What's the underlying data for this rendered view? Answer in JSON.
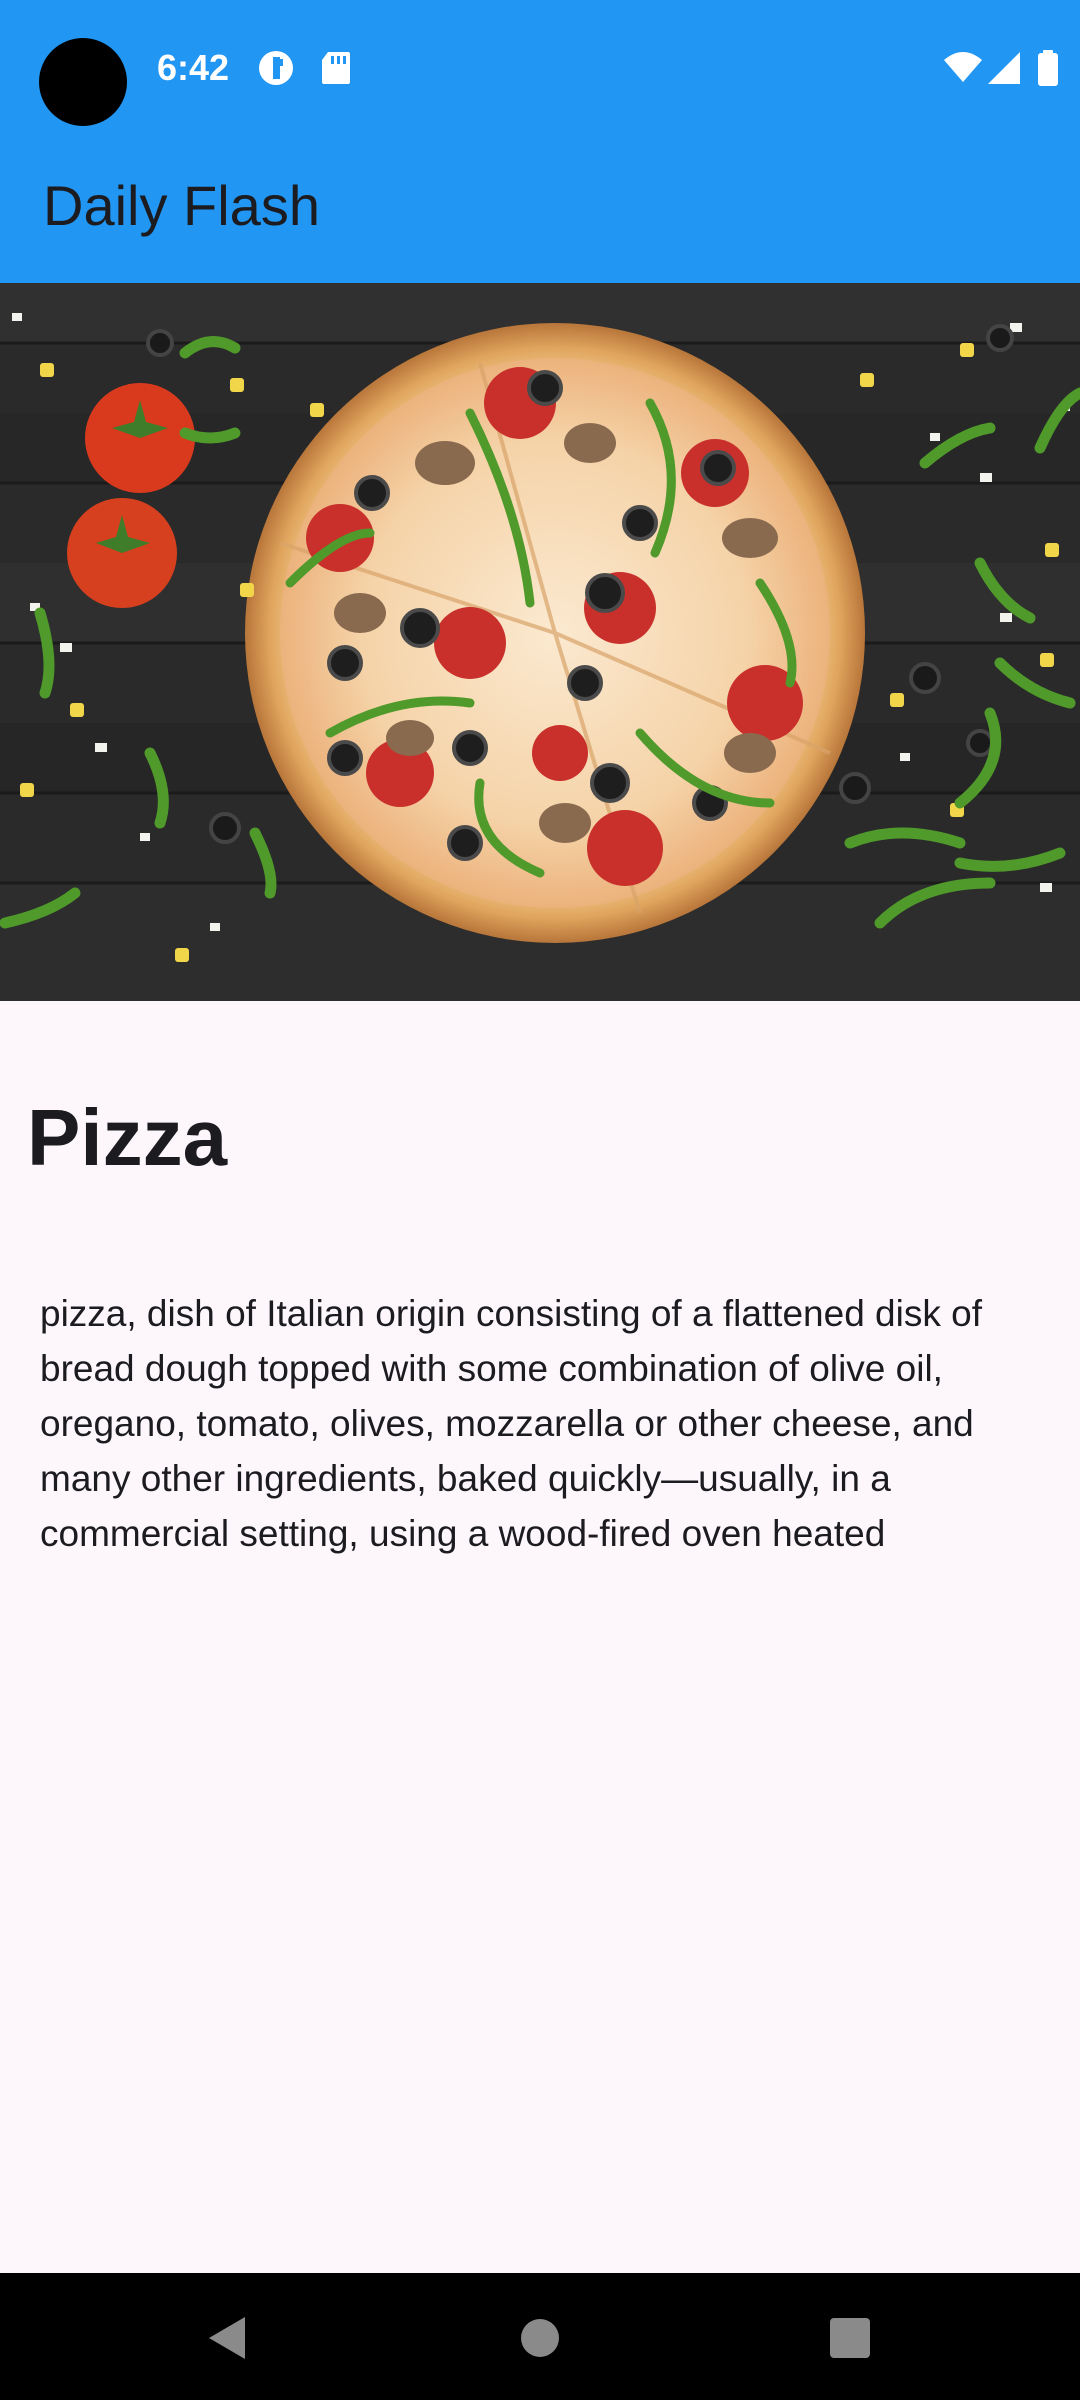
{
  "status_bar": {
    "time": "6:42",
    "icons": [
      "data-saver-icon",
      "sd-card-icon",
      "wifi-icon",
      "cellular-signal-icon",
      "battery-icon"
    ]
  },
  "app_bar": {
    "title": "Daily Flash"
  },
  "article": {
    "image_subject": "pizza-image",
    "title": "Pizza",
    "description": "pizza, dish of Italian origin consisting of a flattened disk of bread dough topped with some combination of olive oil, oregano, tomato, olives, mozzarella or other cheese, and many other ingredients, baked quickly—usually, in a commercial setting, using a wood-fired oven heated"
  },
  "nav_bar": {
    "icons": [
      "back-icon",
      "home-icon",
      "recents-icon"
    ]
  },
  "colors": {
    "app_bar": "#2196f3",
    "background": "#fdf7fc",
    "text": "#1c1b1f",
    "nav_bar": "#000000"
  }
}
